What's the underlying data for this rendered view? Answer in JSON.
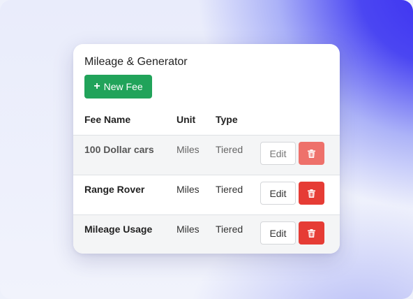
{
  "card": {
    "title": "Mileage & Generator",
    "new_fee_label": "New Fee"
  },
  "table": {
    "headers": {
      "name": "Fee Name",
      "unit": "Unit",
      "type": "Type"
    },
    "rows": [
      {
        "name": "100 Dollar cars",
        "unit": "Miles",
        "type": "Tiered",
        "edit_label": "Edit"
      },
      {
        "name": "Range Rover",
        "unit": "Miles",
        "type": "Tiered",
        "edit_label": "Edit"
      },
      {
        "name": "Mileage Usage",
        "unit": "Miles",
        "type": "Tiered",
        "edit_label": "Edit"
      }
    ]
  },
  "colors": {
    "primary_green": "#21a35a",
    "danger_red": "#e63c35",
    "danger_red_faded": "#ee716b",
    "accent_blue": "#3a2df0"
  },
  "icons": {
    "new_fee": "plus-icon",
    "delete": "trash-icon"
  }
}
